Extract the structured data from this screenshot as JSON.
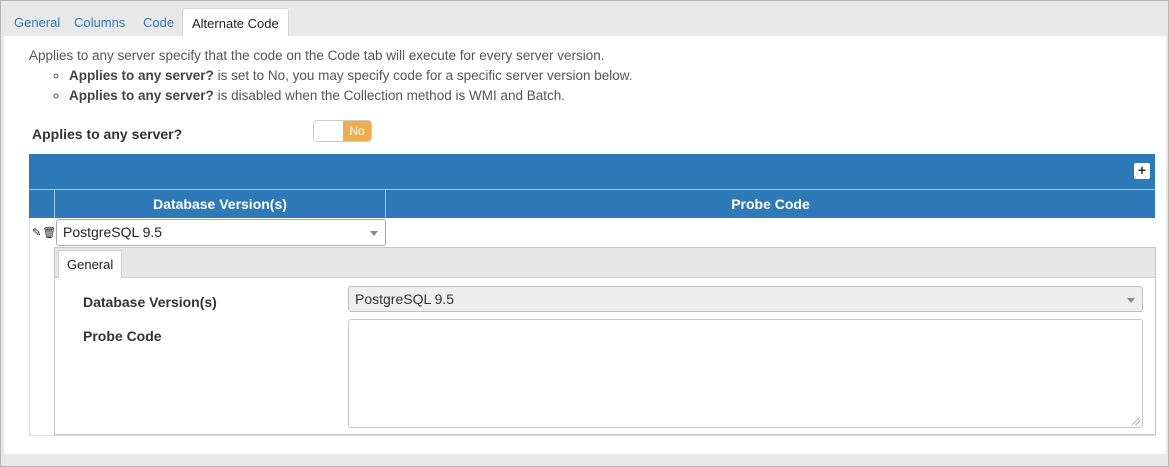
{
  "tabs": [
    {
      "label": "General",
      "active": false
    },
    {
      "label": "Columns",
      "active": false
    },
    {
      "label": "Code",
      "active": false
    },
    {
      "label": "Alternate Code",
      "active": true
    }
  ],
  "description": {
    "intro": "Applies to any server specify that the code on the Code tab will execute for every server version.",
    "bullets": [
      {
        "bold": "Applies to any server?",
        "rest": " is set to No, you may specify code for a specific server version below."
      },
      {
        "bold": "Applies to any server?",
        "rest": " is disabled when the Collection method is WMI and Batch."
      }
    ]
  },
  "applies_field": {
    "label": "Applies to any server?",
    "toggle_value": "No",
    "toggle_color": "#f0ad4e"
  },
  "grid": {
    "header_color": "#2e7ab8",
    "add_icon": "plus-icon",
    "columns": [
      "Database Version(s)",
      "Probe Code"
    ],
    "rows": [
      {
        "database_version": "PostgreSQL 9.5",
        "probe_code": "",
        "icons": [
          "edit-icon",
          "delete-icon"
        ]
      }
    ]
  },
  "detail": {
    "tab_label": "General",
    "db_label": "Database Version(s)",
    "db_value": "PostgreSQL 9.5",
    "probe_label": "Probe Code",
    "probe_value": ""
  }
}
